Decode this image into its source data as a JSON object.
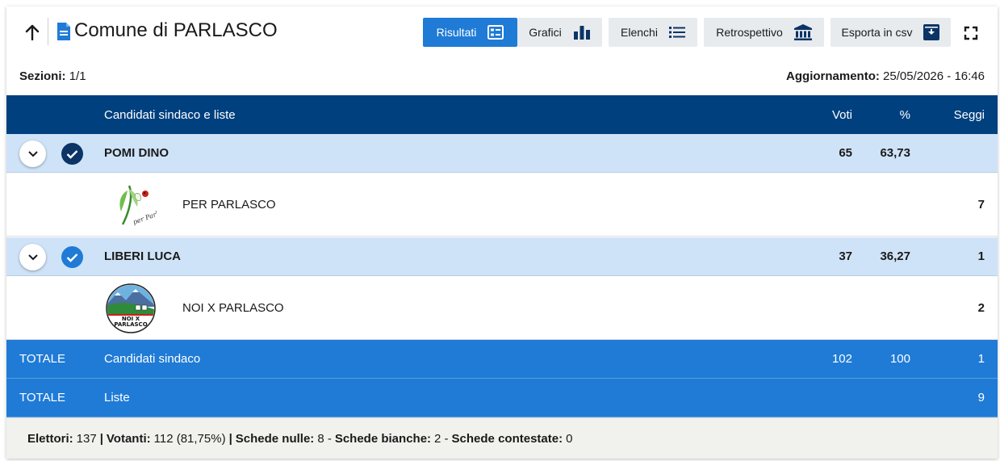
{
  "header": {
    "title": "Comune di PARLASCO",
    "buttons": {
      "risultati": "Risultati",
      "grafici": "Grafici",
      "elenchi": "Elenchi",
      "retrospettivo": "Retrospettivo",
      "esporta": "Esporta in csv"
    }
  },
  "meta": {
    "sezioni_label": "Sezioni:",
    "sezioni_value": "1/1",
    "aggiornamento_label": "Aggiornamento:",
    "aggiornamento_value": "25/05/2026 - 16:46"
  },
  "table": {
    "columns": {
      "candidati": "Candidati sindaco e liste",
      "voti": "Voti",
      "perc": "%",
      "seggi": "Seggi"
    },
    "candidates": [
      {
        "name": "POMI DINO",
        "voti": "65",
        "perc": "63,73",
        "seggi": "",
        "list": {
          "name": "PER PARLASCO",
          "seggi": "7",
          "logo_text": "per Parlasco"
        }
      },
      {
        "name": "LIBERI LUCA",
        "voti": "37",
        "perc": "36,27",
        "seggi": "1",
        "list": {
          "name": "NOI X PARLASCO",
          "seggi": "2",
          "logo_text_1": "NOI X",
          "logo_text_2": "PARLASCO"
        }
      }
    ],
    "totals": [
      {
        "label": "TOTALE",
        "desc": "Candidati sindaco",
        "voti": "102",
        "perc": "100",
        "seggi": "1"
      },
      {
        "label": "TOTALE",
        "desc": "Liste",
        "voti": "",
        "perc": "",
        "seggi": "9"
      }
    ]
  },
  "footer": {
    "elettori_label": "Elettori:",
    "elettori_value": "137",
    "sep1": "|",
    "votanti_label": "Votanti:",
    "votanti_value": "112 (81,75%)",
    "sep2": "|",
    "nulle_label": "Schede nulle:",
    "nulle_value": "8 -",
    "bianche_label": "Schede bianche:",
    "bianche_value": "2 -",
    "contestate_label": "Schede contestate:",
    "contestate_value": "0"
  },
  "colors": {
    "header_dark": "#00407f",
    "accent": "#1f7bd6",
    "candidate_row": "#cfe3f8",
    "check_dark": "#0c3466",
    "check_light": "#1f7bd6"
  },
  "icons": {
    "up": "arrow-up-icon",
    "doc": "document-icon",
    "risultati": "list-details-icon",
    "grafici": "bar-chart-icon",
    "elenchi": "bullet-list-icon",
    "retrospettivo": "bank-icon",
    "esporta": "download-box-icon",
    "fullscreen": "fullscreen-icon"
  }
}
